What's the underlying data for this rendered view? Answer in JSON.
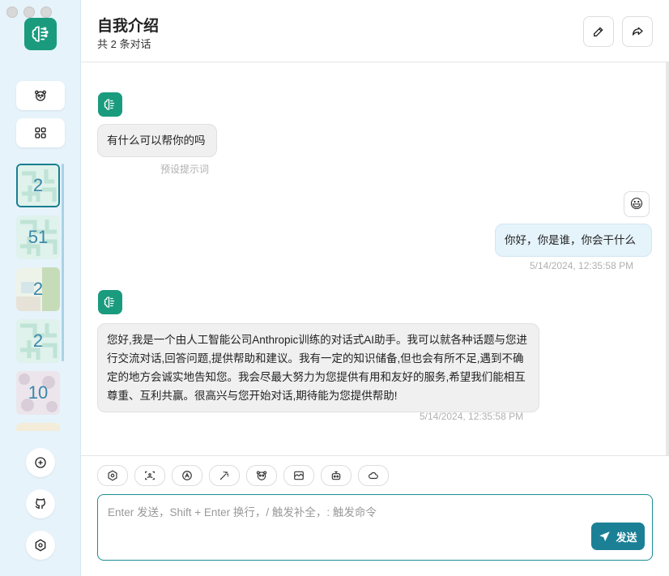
{
  "sidebar": {
    "masks": [
      {
        "label": "2",
        "colors": [
          "#d9f0ea",
          "#b9e2d4"
        ]
      },
      {
        "label": "51",
        "colors": [
          "#d9f0ea",
          "#b9e2d4"
        ]
      },
      {
        "label": "2",
        "colors": [
          "#e2f0e6",
          "#c9d9c2"
        ]
      },
      {
        "label": "2",
        "colors": [
          "#d9f0ea",
          "#b9e2d4"
        ]
      },
      {
        "label": "10",
        "colors": [
          "#ebe3ea",
          "#d6cad6"
        ]
      }
    ]
  },
  "header": {
    "title": "自我介绍",
    "subtitle": "共 2 条对话"
  },
  "messages": [
    {
      "role": "assistant",
      "text": "有什么可以帮你的吗",
      "meta": "预设提示词"
    },
    {
      "role": "user",
      "text": "你好，你是谁，你会干什么",
      "meta": "5/14/2024, 12:35:58 PM",
      "emoji": "😃"
    },
    {
      "role": "assistant",
      "text": "您好,我是一个由人工智能公司Anthropic训练的对话式AI助手。我可以就各种话题与您进行交流对话,回答问题,提供帮助和建议。我有一定的知识储备,但也会有所不足,遇到不确定的地方会诚实地告知您。我会尽最大努力为您提供有用和友好的服务,希望我们能相互尊重、互利共赢。很高兴与您开始对话,期待能为您提供帮助!",
      "meta": "5/14/2024, 12:35:58 PM"
    }
  ],
  "input": {
    "placeholder": "Enter 发送，Shift + Enter 换行，/ 触发补全，: 触发命令",
    "send_label": "发送"
  },
  "tools": [
    "settings-icon",
    "image-icon",
    "model-icon",
    "magic-wand-icon",
    "mask-icon",
    "chart-icon",
    "robot-icon",
    "cloud-icon"
  ],
  "accent": "#1b8096"
}
